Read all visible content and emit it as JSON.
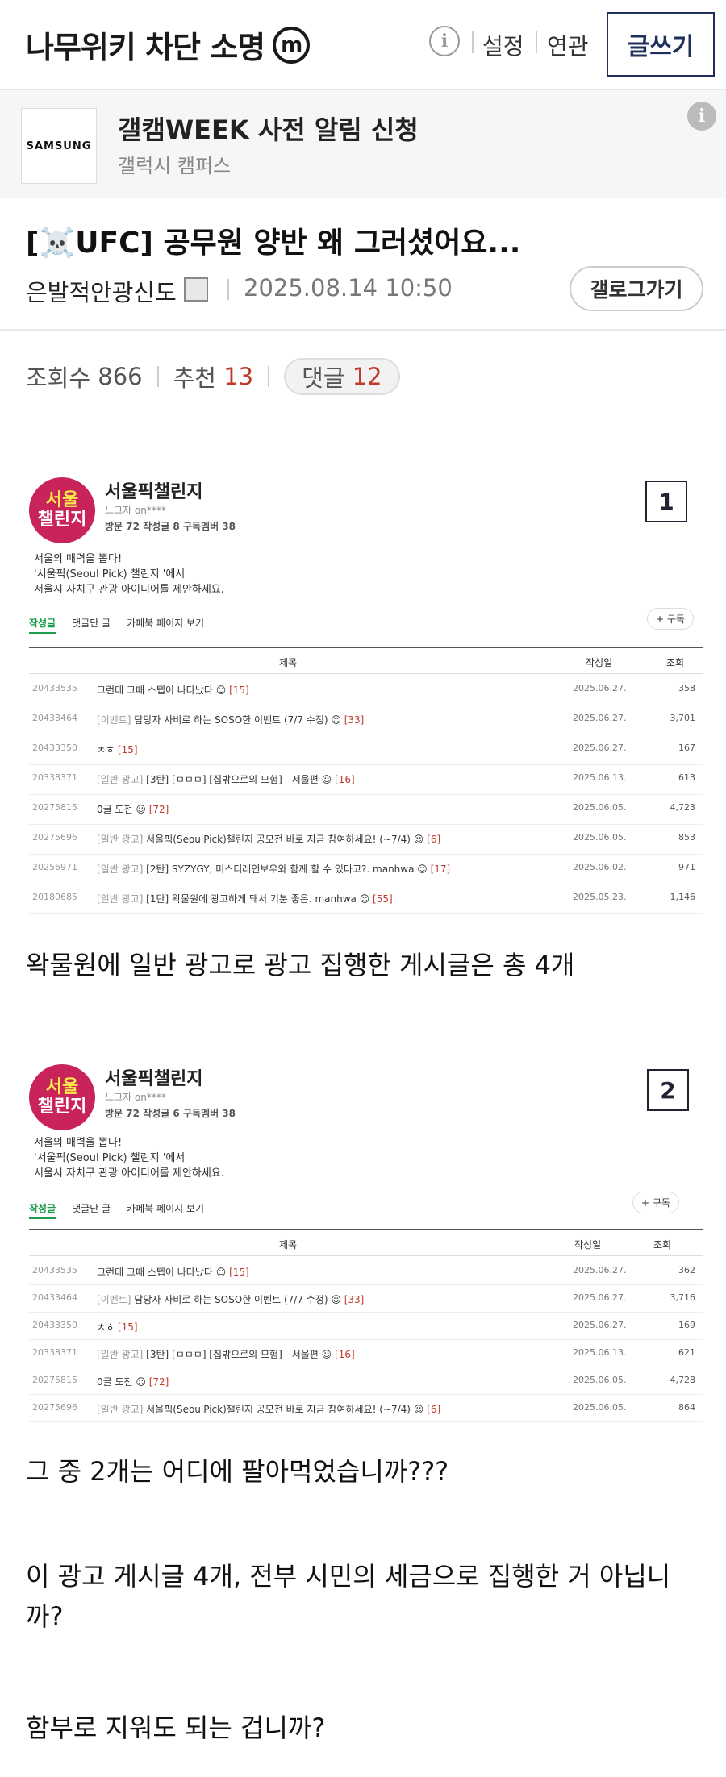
{
  "header": {
    "site_title": "나무위키 차단 소명",
    "site_badge": "m",
    "info_icon": "info-icon",
    "settings_label": "설정",
    "related_label": "연관",
    "write_button": "글쓰기"
  },
  "ad": {
    "brand": "SAMSUNG",
    "title": "갤캠WEEK 사전 알림 신청",
    "subtitle": "갤럭시 캠퍼스",
    "info_icon": "info-icon"
  },
  "post": {
    "title": "[☠️UFC] 공무원 양반 왜 그러셨어요...",
    "author": "은발적안광신도",
    "date": "2025.08.14 10:50",
    "gallog_button": "갤로그가기",
    "views_label": "조회수",
    "views": "866",
    "recommend_label": "추천",
    "recommend": "13",
    "comments_label": "댓글",
    "comments": "12"
  },
  "shot1": {
    "number": "1",
    "logo_line1": "서울",
    "logo_line2": "챌린지",
    "cafe_name": "서울픽챌린지",
    "level": "느그자 on****",
    "meta": "방문 72  작성글 8  구독멤버 38",
    "desc1": "서울의 매력을 뽑다!",
    "desc2": "'서울픽(Seoul Pick) 챌린지 '에서",
    "desc3": "서울시 자치구 관광 아이디어를 제안하세요.",
    "tab1": "작성글",
    "tab2": "댓글단 글",
    "tab3": "카페북 페이지 보기",
    "subscribe": "+ 구독",
    "col_title": "제목",
    "col_date": "작성일",
    "col_views": "조회",
    "rows": [
      {
        "id": "20433535",
        "cat": "",
        "title": "그런데 그때 스텝이 나타났다 ☺",
        "cnt": "[15]",
        "date": "2025.06.27.",
        "views": "358"
      },
      {
        "id": "20433464",
        "cat": "[이벤트]",
        "title": " 담당자 사비로 하는 SOSO한 이벤트 (7/7 수정) ☺",
        "cnt": "[33]",
        "date": "2025.06.27.",
        "views": "3,701"
      },
      {
        "id": "20433350",
        "cat": "",
        "title": "ㅊㅎ",
        "cnt": "[15]",
        "date": "2025.06.27.",
        "views": "167"
      },
      {
        "id": "20338371",
        "cat": "[일반 광고]",
        "title": " [3탄] [ㅁㅁㅁ] [집밖으로의 모험] - 서울편 ☺",
        "cnt": "[16]",
        "date": "2025.06.13.",
        "views": "613"
      },
      {
        "id": "20275815",
        "cat": "",
        "title": "0글 도전 ☺",
        "cnt": "[72]",
        "date": "2025.06.05.",
        "views": "4,723"
      },
      {
        "id": "20275696",
        "cat": "[일반 광고]",
        "title": " 서울픽(SeoulPick)챌린지 공모전 바로 지금 참여하세요! (~7/4) ☺",
        "cnt": "[6]",
        "date": "2025.06.05.",
        "views": "853"
      },
      {
        "id": "20256971",
        "cat": "[일반 광고]",
        "title": " [2탄] SYZYGY, 미스티레인보우와 함께 할 수 있다고?. manhwa ☺",
        "cnt": "[17]",
        "date": "2025.06.02.",
        "views": "971"
      },
      {
        "id": "20180685",
        "cat": "[일반 광고]",
        "title": " [1탄] 왁물원에 광고하게 돼서 기분 좋은. manhwa ☺",
        "cnt": "[55]",
        "date": "2025.05.23.",
        "views": "1,146"
      }
    ]
  },
  "text1": "왁물원에 일반 광고로 광고 집행한 게시글은 총 4개",
  "shot2": {
    "number": "2",
    "logo_line1": "서울",
    "logo_line2": "챌린지",
    "cafe_name": "서울픽챌린지",
    "level": "느그자 on****",
    "meta": "방문 72  작성글 6  구독멤버 38",
    "desc1": "서울의 매력을 뽑다!",
    "desc2": "'서울픽(Seoul Pick) 챌린지 '에서",
    "desc3": "서울시 자치구 관광 아이디어를 제안하세요.",
    "tab1": "작성글",
    "tab2": "댓글단 글",
    "tab3": "카페북 페이지 보기",
    "subscribe": "+ 구독",
    "col_title": "제목",
    "col_date": "작성일",
    "col_views": "조회",
    "rows": [
      {
        "id": "20433535",
        "cat": "",
        "title": "그런데 그때 스텝이 나타났다 ☺",
        "cnt": "[15]",
        "date": "2025.06.27.",
        "views": "362"
      },
      {
        "id": "20433464",
        "cat": "[이벤트]",
        "title": " 담당자 사비로 하는 SOSO한 이벤트 (7/7 수정) ☺",
        "cnt": "[33]",
        "date": "2025.06.27.",
        "views": "3,716"
      },
      {
        "id": "20433350",
        "cat": "",
        "title": "ㅊㅎ",
        "cnt": "[15]",
        "date": "2025.06.27.",
        "views": "169"
      },
      {
        "id": "20338371",
        "cat": "[일반 광고]",
        "title": " [3탄] [ㅁㅁㅁ] [집밖으로의 모험] - 서울편 ☺",
        "cnt": "[16]",
        "date": "2025.06.13.",
        "views": "621"
      },
      {
        "id": "20275815",
        "cat": "",
        "title": "0글 도전 ☺",
        "cnt": "[72]",
        "date": "2025.06.05.",
        "views": "4,728"
      },
      {
        "id": "20275696",
        "cat": "[일반 광고]",
        "title": " 서울픽(SeoulPick)챌린지 공모전 바로 지금 참여하세요! (~7/4) ☺",
        "cnt": "[6]",
        "date": "2025.06.05.",
        "views": "864"
      }
    ]
  },
  "text2": "그 중 2개는 어디에 팔아먹었습니까???",
  "text3a": "이 광고 게시글 4개, 전부 시민의 세금으로 집행한 거 아닙니",
  "text3b": "까?",
  "text4": "함부로 지워도 되는 겁니까?"
}
